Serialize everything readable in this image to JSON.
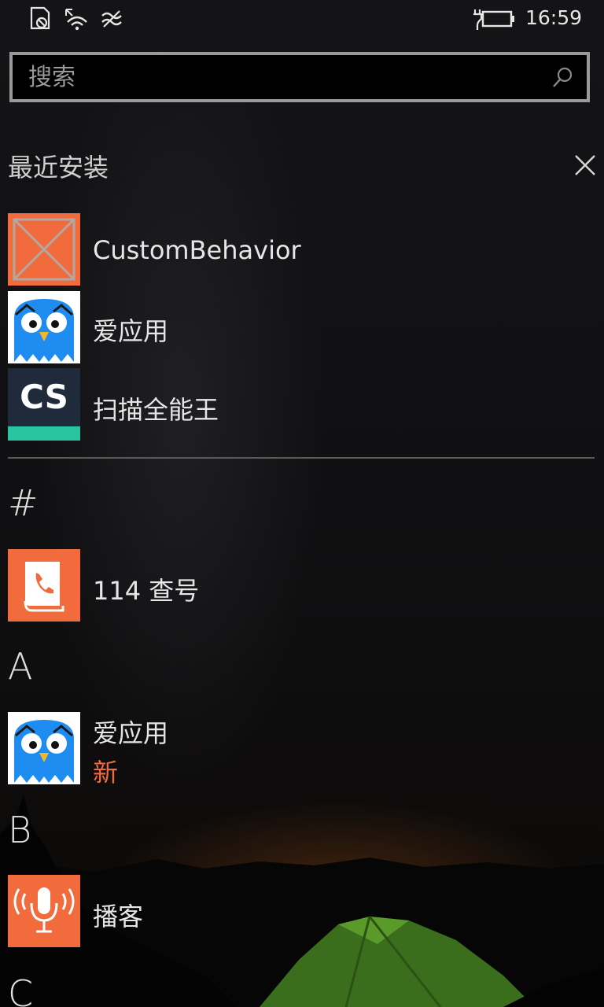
{
  "status_bar": {
    "time": "16:59",
    "icons": [
      "no-sim-icon",
      "wifi-icon",
      "signal-icon",
      "battery-charging-icon"
    ]
  },
  "search": {
    "placeholder": "搜索",
    "icon": "search-icon"
  },
  "recent": {
    "title": "最近安装",
    "close_icon": "close-icon",
    "apps": [
      {
        "name": "CustomBehavior",
        "icon": "placeholder-tile-icon",
        "color": "#f26b3c"
      },
      {
        "name": "爱应用",
        "icon": "owl-icon",
        "color": "#ffffff"
      },
      {
        "name": "扫描全能王",
        "icon": "cs-logo-icon",
        "color": "#1f2a3a",
        "logo_text": "CS"
      }
    ]
  },
  "all_apps": {
    "groups": [
      {
        "letter": "#",
        "apps": [
          {
            "name": "114 查号",
            "icon": "phone-book-icon",
            "color": "#f26b3c"
          }
        ]
      },
      {
        "letter": "A",
        "apps": [
          {
            "name": "爱应用",
            "badge": "新",
            "icon": "owl-icon",
            "color": "#ffffff"
          }
        ]
      },
      {
        "letter": "B",
        "apps": [
          {
            "name": "播客",
            "icon": "microphone-icon",
            "color": "#f26b3c"
          }
        ]
      },
      {
        "letter": "C",
        "apps": []
      }
    ]
  },
  "colors": {
    "accent": "#f26b3c",
    "new_badge": "#f26b3c",
    "cs_green": "#2bc4a0"
  }
}
